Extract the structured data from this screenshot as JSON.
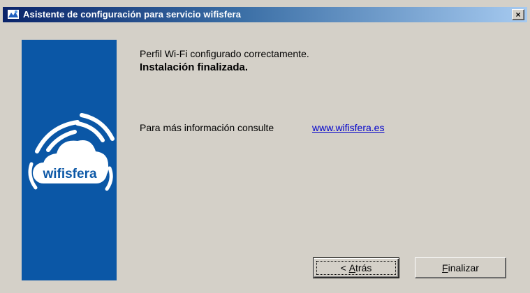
{
  "window": {
    "title": "Asistente de configuración para servicio wifisfera",
    "close_symbol": "×"
  },
  "banner": {
    "logo_text": "wifisfera",
    "background": "#0b57a6"
  },
  "content": {
    "status_line": "Perfil Wi-Fi configurado correctamente.",
    "status_bold": "Instalación finalizada.",
    "info_text": "Para más información consulte",
    "info_link": "www.wifisfera.es"
  },
  "buttons": {
    "back_arrow": "<",
    "back_mnemonic": "A",
    "back_rest": "trás",
    "finish_mnemonic": "F",
    "finish_rest": "inalizar"
  },
  "icons": {
    "title_icon": "setup-wizard-icon",
    "close_icon": "close-icon",
    "logo": "wifisfera-logo"
  }
}
